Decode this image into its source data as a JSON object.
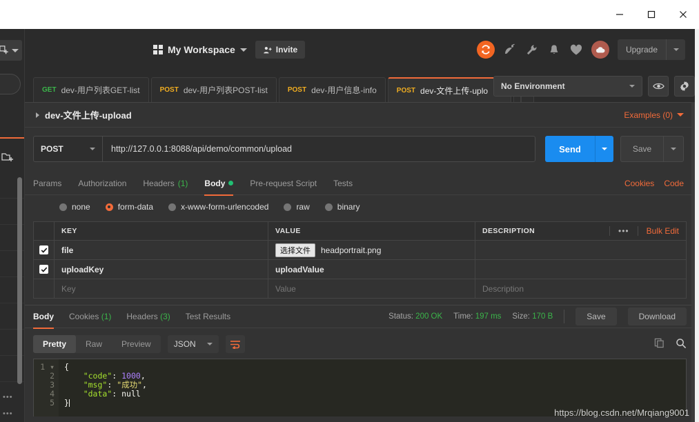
{
  "window": {
    "minimize_label": "Minimize",
    "maximize_label": "Maximize",
    "close_label": "Close"
  },
  "left_rail": {
    "new_button_label": "New",
    "new_collection_icon": "new-collection-icon",
    "search_placeholder": ""
  },
  "header": {
    "grid_icon": "grid-icon",
    "workspace_name": "My Workspace",
    "invite_label": "Invite",
    "icons": [
      "sync-icon",
      "satellite-dish-icon",
      "wrench-icon",
      "bell-icon",
      "heart-icon",
      "cloud-avatar-icon"
    ],
    "upgrade_label": "Upgrade"
  },
  "tabs": [
    {
      "method": "GET",
      "title": "dev-用户列表GET-list",
      "active": false
    },
    {
      "method": "POST",
      "title": "dev-用户列表POST-list",
      "active": false
    },
    {
      "method": "POST",
      "title": "dev-用户信息-info",
      "active": false
    },
    {
      "method": "POST",
      "title": "dev-文件上传-uplo",
      "active": true
    }
  ],
  "tab_controls": {
    "add_label": "+",
    "more_label": "•••"
  },
  "environment": {
    "selected": "No Environment",
    "eye_icon": "eye-icon",
    "settings_icon": "gear-icon"
  },
  "request": {
    "name": "dev-文件上传-upload",
    "examples_label": "Examples (0)",
    "method": "POST",
    "url": "http://127.0.0.1:8088/api/demo/common/upload",
    "send_label": "Send",
    "save_label": "Save",
    "tabs": [
      {
        "label": "Params",
        "count": "",
        "active": false,
        "dot": false
      },
      {
        "label": "Authorization",
        "count": "",
        "active": false,
        "dot": false
      },
      {
        "label": "Headers",
        "count": "(1)",
        "active": false,
        "dot": false
      },
      {
        "label": "Body",
        "count": "",
        "active": true,
        "dot": true
      },
      {
        "label": "Pre-request Script",
        "count": "",
        "active": false,
        "dot": false
      },
      {
        "label": "Tests",
        "count": "",
        "active": false,
        "dot": false
      }
    ],
    "cookies_link": "Cookies",
    "code_link": "Code",
    "body_types": [
      {
        "label": "none",
        "selected": false
      },
      {
        "label": "form-data",
        "selected": true
      },
      {
        "label": "x-www-form-urlencoded",
        "selected": false
      },
      {
        "label": "raw",
        "selected": false
      },
      {
        "label": "binary",
        "selected": false
      }
    ],
    "table": {
      "headers": {
        "key": "KEY",
        "value": "VALUE",
        "description": "DESCRIPTION"
      },
      "more_label": "•••",
      "bulk_edit_label": "Bulk Edit",
      "rows": [
        {
          "checked": true,
          "key": "file",
          "file_button_label": "选择文件",
          "value": "headportrait.png",
          "description": "",
          "is_file": true
        },
        {
          "checked": true,
          "key": "uploadKey",
          "value": "uploadValue",
          "description": "",
          "is_file": false
        }
      ],
      "placeholder_row": {
        "key": "Key",
        "value": "Value",
        "description": "Description"
      }
    }
  },
  "response": {
    "tabs": [
      {
        "label": "Body",
        "count": "",
        "active": true
      },
      {
        "label": "Cookies",
        "count": "(1)",
        "active": false
      },
      {
        "label": "Headers",
        "count": "(3)",
        "active": false
      },
      {
        "label": "Test Results",
        "count": "",
        "active": false
      }
    ],
    "status_label": "Status:",
    "status_value": "200 OK",
    "time_label": "Time:",
    "time_value": "197 ms",
    "size_label": "Size:",
    "size_value": "170 B",
    "save_label": "Save",
    "download_label": "Download",
    "view_modes": [
      {
        "label": "Pretty",
        "active": true
      },
      {
        "label": "Raw",
        "active": false
      },
      {
        "label": "Preview",
        "active": false
      }
    ],
    "language": "JSON",
    "wrap_icon": "word-wrap-icon",
    "copy_icon": "copy-icon",
    "search_icon": "search-icon",
    "body_lines": [
      {
        "n": "1",
        "fold": true,
        "tokens": [
          {
            "t": "punc",
            "v": "{"
          }
        ]
      },
      {
        "n": "2",
        "fold": false,
        "tokens": [
          {
            "t": "plain",
            "v": "    "
          },
          {
            "t": "key",
            "v": "\"code\""
          },
          {
            "t": "punc",
            "v": ": "
          },
          {
            "t": "num",
            "v": "1000"
          },
          {
            "t": "punc",
            "v": ","
          }
        ]
      },
      {
        "n": "3",
        "fold": false,
        "tokens": [
          {
            "t": "plain",
            "v": "    "
          },
          {
            "t": "key",
            "v": "\"msg\""
          },
          {
            "t": "punc",
            "v": ": "
          },
          {
            "t": "str",
            "v": "\"成功\""
          },
          {
            "t": "punc",
            "v": ","
          }
        ]
      },
      {
        "n": "4",
        "fold": false,
        "tokens": [
          {
            "t": "plain",
            "v": "    "
          },
          {
            "t": "key",
            "v": "\"data\""
          },
          {
            "t": "punc",
            "v": ": "
          },
          {
            "t": "null",
            "v": "null"
          }
        ]
      },
      {
        "n": "5",
        "fold": false,
        "tokens": [
          {
            "t": "punc",
            "v": "}"
          }
        ]
      }
    ]
  },
  "watermark": "https://blog.csdn.net/Mrqiang9001",
  "colors": {
    "accent_orange": "#f26b3a",
    "send_blue": "#1a8cf0",
    "status_green": "#3bb54a",
    "method_get": "#3bb54a",
    "method_post": "#f0ad21",
    "app_bg": "#2b2b2b",
    "pane_bg": "#333333",
    "code_bg": "#272822"
  }
}
